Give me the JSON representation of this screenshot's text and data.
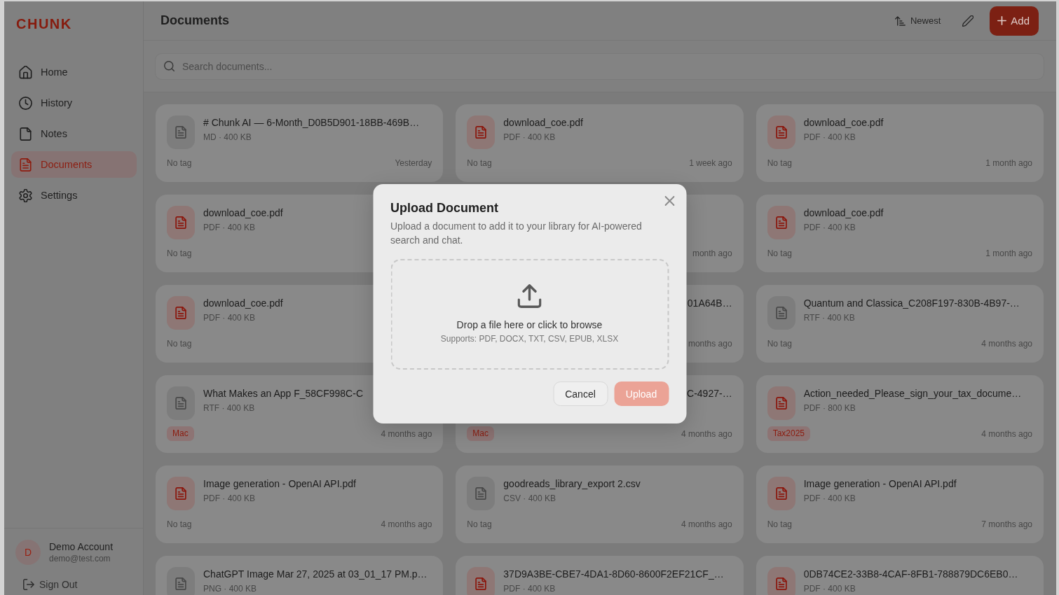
{
  "logo": "CHUNK",
  "sidebar": {
    "items": [
      {
        "label": "Home",
        "selected": false
      },
      {
        "label": "History",
        "selected": false
      },
      {
        "label": "Notes",
        "selected": false
      },
      {
        "label": "Documents",
        "selected": true
      },
      {
        "label": "Settings",
        "selected": false
      }
    ]
  },
  "account": {
    "avatar_initial": "D",
    "name": "Demo Account",
    "email": "demo@test.com",
    "sign_out": "Sign Out"
  },
  "header": {
    "title": "Documents",
    "sort": "Newest",
    "add_button": "Add"
  },
  "search": {
    "placeholder": "Search documents..."
  },
  "documents": [
    {
      "kind": "card",
      "title": "# Chunk AI — 6-Month_D0B5D901-18BB-469B…",
      "meta": "MD · 400 KB",
      "color": "#7d7d7d",
      "tag": {
        "kind": "none",
        "label": "No tag"
      },
      "date": "Yesterday"
    },
    {
      "kind": "card",
      "title": "download_coe.pdf",
      "meta": "PDF · 400 KB",
      "color": "#8e7775",
      "tag": {
        "kind": "none",
        "label": "No tag"
      },
      "date": "1 week ago"
    },
    {
      "kind": "card",
      "title": "download_coe.pdf",
      "meta": "PDF · 400 KB",
      "color": "#8e7775",
      "tag": {
        "kind": "none",
        "label": "No tag"
      },
      "date": "1 month ago"
    },
    {
      "kind": "card",
      "title": "download_coe.pdf",
      "meta": "PDF · 400 KB",
      "color": "#8e7775",
      "tag": {
        "kind": "none",
        "label": "No tag"
      }
    },
    {
      "kind": "covered",
      "date": "month ago"
    },
    {
      "kind": "card",
      "title": "download_coe.pdf",
      "meta": "PDF · 400 KB",
      "color": "#8e7775",
      "tag": {
        "kind": "none",
        "label": "No tag"
      },
      "date": "1 month ago"
    },
    {
      "kind": "card",
      "title": "download_coe.pdf",
      "meta": "PDF · 400 KB",
      "color": "#8e7775",
      "tag": {
        "kind": "none",
        "label": "No tag"
      }
    },
    {
      "kind": "covered",
      "title": "01A64B…",
      "date": "months ago"
    },
    {
      "kind": "card",
      "title": "Quantum and Classica_C208F197-830B-4B97-…",
      "meta": "RTF · 400 KB",
      "color": "#7d7d7d",
      "tag": {
        "kind": "none",
        "label": "No tag"
      },
      "date": "4 months ago"
    },
    {
      "kind": "card",
      "title": "What Makes an App F_58CF998C-C",
      "meta": "RTF · 400 KB",
      "color": "#7d7d7d",
      "tag": {
        "kind": "badge",
        "label": "Mac"
      },
      "date": "4 months ago"
    },
    {
      "kind": "covered",
      "title": "C-4927-…",
      "tag": {
        "kind": "badge",
        "label": "Mac"
      },
      "date": "4 months ago"
    },
    {
      "kind": "card",
      "title": "Action_needed_Please_sign_your_tax_docume…",
      "meta": "PDF · 800 KB",
      "color": "#8e7775",
      "tag": {
        "kind": "badge",
        "label": "Tax2025"
      },
      "date": "4 months ago"
    },
    {
      "kind": "card",
      "title": "Image generation - OpenAI API.pdf",
      "meta": "PDF · 400 KB",
      "color": "#8e7775",
      "tag": {
        "kind": "none",
        "label": "No tag"
      },
      "date": "4 months ago"
    },
    {
      "kind": "card",
      "title": "goodreads_library_export 2.csv",
      "meta": "CSV · 400 KB",
      "color": "#7d7d7d",
      "tag": {
        "kind": "none",
        "label": "No tag"
      },
      "date": "4 months ago"
    },
    {
      "kind": "card",
      "title": "Image generation - OpenAI API.pdf",
      "meta": "PDF · 400 KB",
      "color": "#8e7775",
      "tag": {
        "kind": "none",
        "label": "No tag"
      },
      "date": "7 months ago"
    },
    {
      "kind": "card",
      "title": "ChatGPT Image Mar 27, 2025 at 03_01_17 PM.p…",
      "meta": "PNG · 400 KB",
      "color": "#7d7d7d"
    },
    {
      "kind": "card",
      "title": "37D9A3BE-CBE7-4DA1-8D60-8600F2EF21CF_…",
      "meta": "PDF · 400 KB",
      "color": "#8e7775"
    },
    {
      "kind": "card",
      "title": "0DB74CE2-33B8-4CAF-8FB1-788879DC6EB0…",
      "meta": "PDF · 400 KB",
      "color": "#8e7775"
    }
  ],
  "modal": {
    "title": "Upload Document",
    "description": "Upload a document to add it to your library for AI-powered search and chat.",
    "dropzone": {
      "prompt": "Drop a file here or click to browse",
      "formats": "Supports: PDF, DOCX, TXT, CSV, EPUB, XLSX"
    },
    "buttons": [
      {
        "label": "Cancel",
        "kind": "secondary",
        "disabled": false
      },
      {
        "label": "Upload",
        "kind": "primary",
        "disabled": true
      }
    ]
  }
}
